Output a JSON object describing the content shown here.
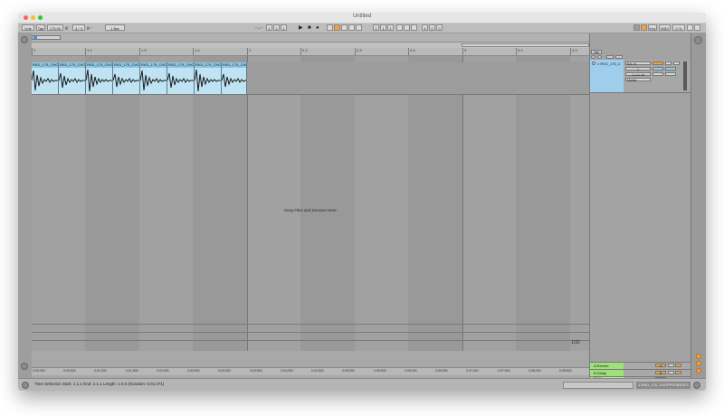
{
  "window": {
    "title": "Untitled"
  },
  "colors": {
    "clip": "#bfe3f3",
    "accent": "#f0a23a",
    "return_green": "#9fe07a",
    "master_green": "#b7f090"
  },
  "control_bar": {
    "link": "Link",
    "tap": "Tap",
    "tempo": "175.00",
    "time_sig": "4 / 4",
    "metro_dots": "||• ∙∙",
    "quantize": "1 Bar",
    "position": [
      "1",
      "1",
      "1"
    ],
    "loop_start": [
      "1",
      "1",
      "1"
    ],
    "loop_length": [
      "4",
      "0",
      "0"
    ],
    "key": "Key",
    "midi": "MIDI",
    "cpu": "0 %",
    "play_icon": "play-icon",
    "stop_icon": "stop-icon",
    "record_icon": "record-icon"
  },
  "ruler": {
    "ticks": [
      "1",
      "1.2",
      "1.3",
      "1.4",
      "2",
      "2.2",
      "2.3",
      "2.4",
      "3",
      "3.2",
      "3.3"
    ]
  },
  "track": {
    "clip_names": [
      "RKD_175_CHO",
      "RKD_175_CHO",
      "RKD_175_CHO",
      "RKD_175_CHO",
      "RKD_175_CHO",
      "RKD_175_CHO",
      "RKD_175_CHO",
      "RKD_175_CHO"
    ],
    "track_name": "1 RKD_175_C",
    "io_from": "Ext. In",
    "io_channel": "1",
    "monitor_label": "In Auto Off",
    "output": "Master",
    "set": "Set"
  },
  "arrangement": {
    "drop_hint": "Drop Files and Devices Here"
  },
  "returns": [
    {
      "name": "A Reverb",
      "letter": "A"
    },
    {
      "name": "B Delay",
      "letter": "B"
    },
    {
      "name": "Master",
      "letter": "M"
    }
  ],
  "page_indicator": "1/32",
  "bottom_times": [
    "0:00:000",
    "0:00:500",
    "0:01:000",
    "0:01:500",
    "0:02:000",
    "0:02:500",
    "0:03:000",
    "0:03:500",
    "0:04:000",
    "0:04:500",
    "0:05:000",
    "0:05:500",
    "0:06:000",
    "0:06:500",
    "0:07:000",
    "0:07:500",
    "0:08:000",
    "0:08:500"
  ],
  "status": {
    "text": "Time Selection   Start: 1.1.1   End: 2.1.1   Length: 1.0.0  (Duration: 0:01:371)",
    "clip": "1-RKD_175_CHOPPEDBEATS"
  }
}
